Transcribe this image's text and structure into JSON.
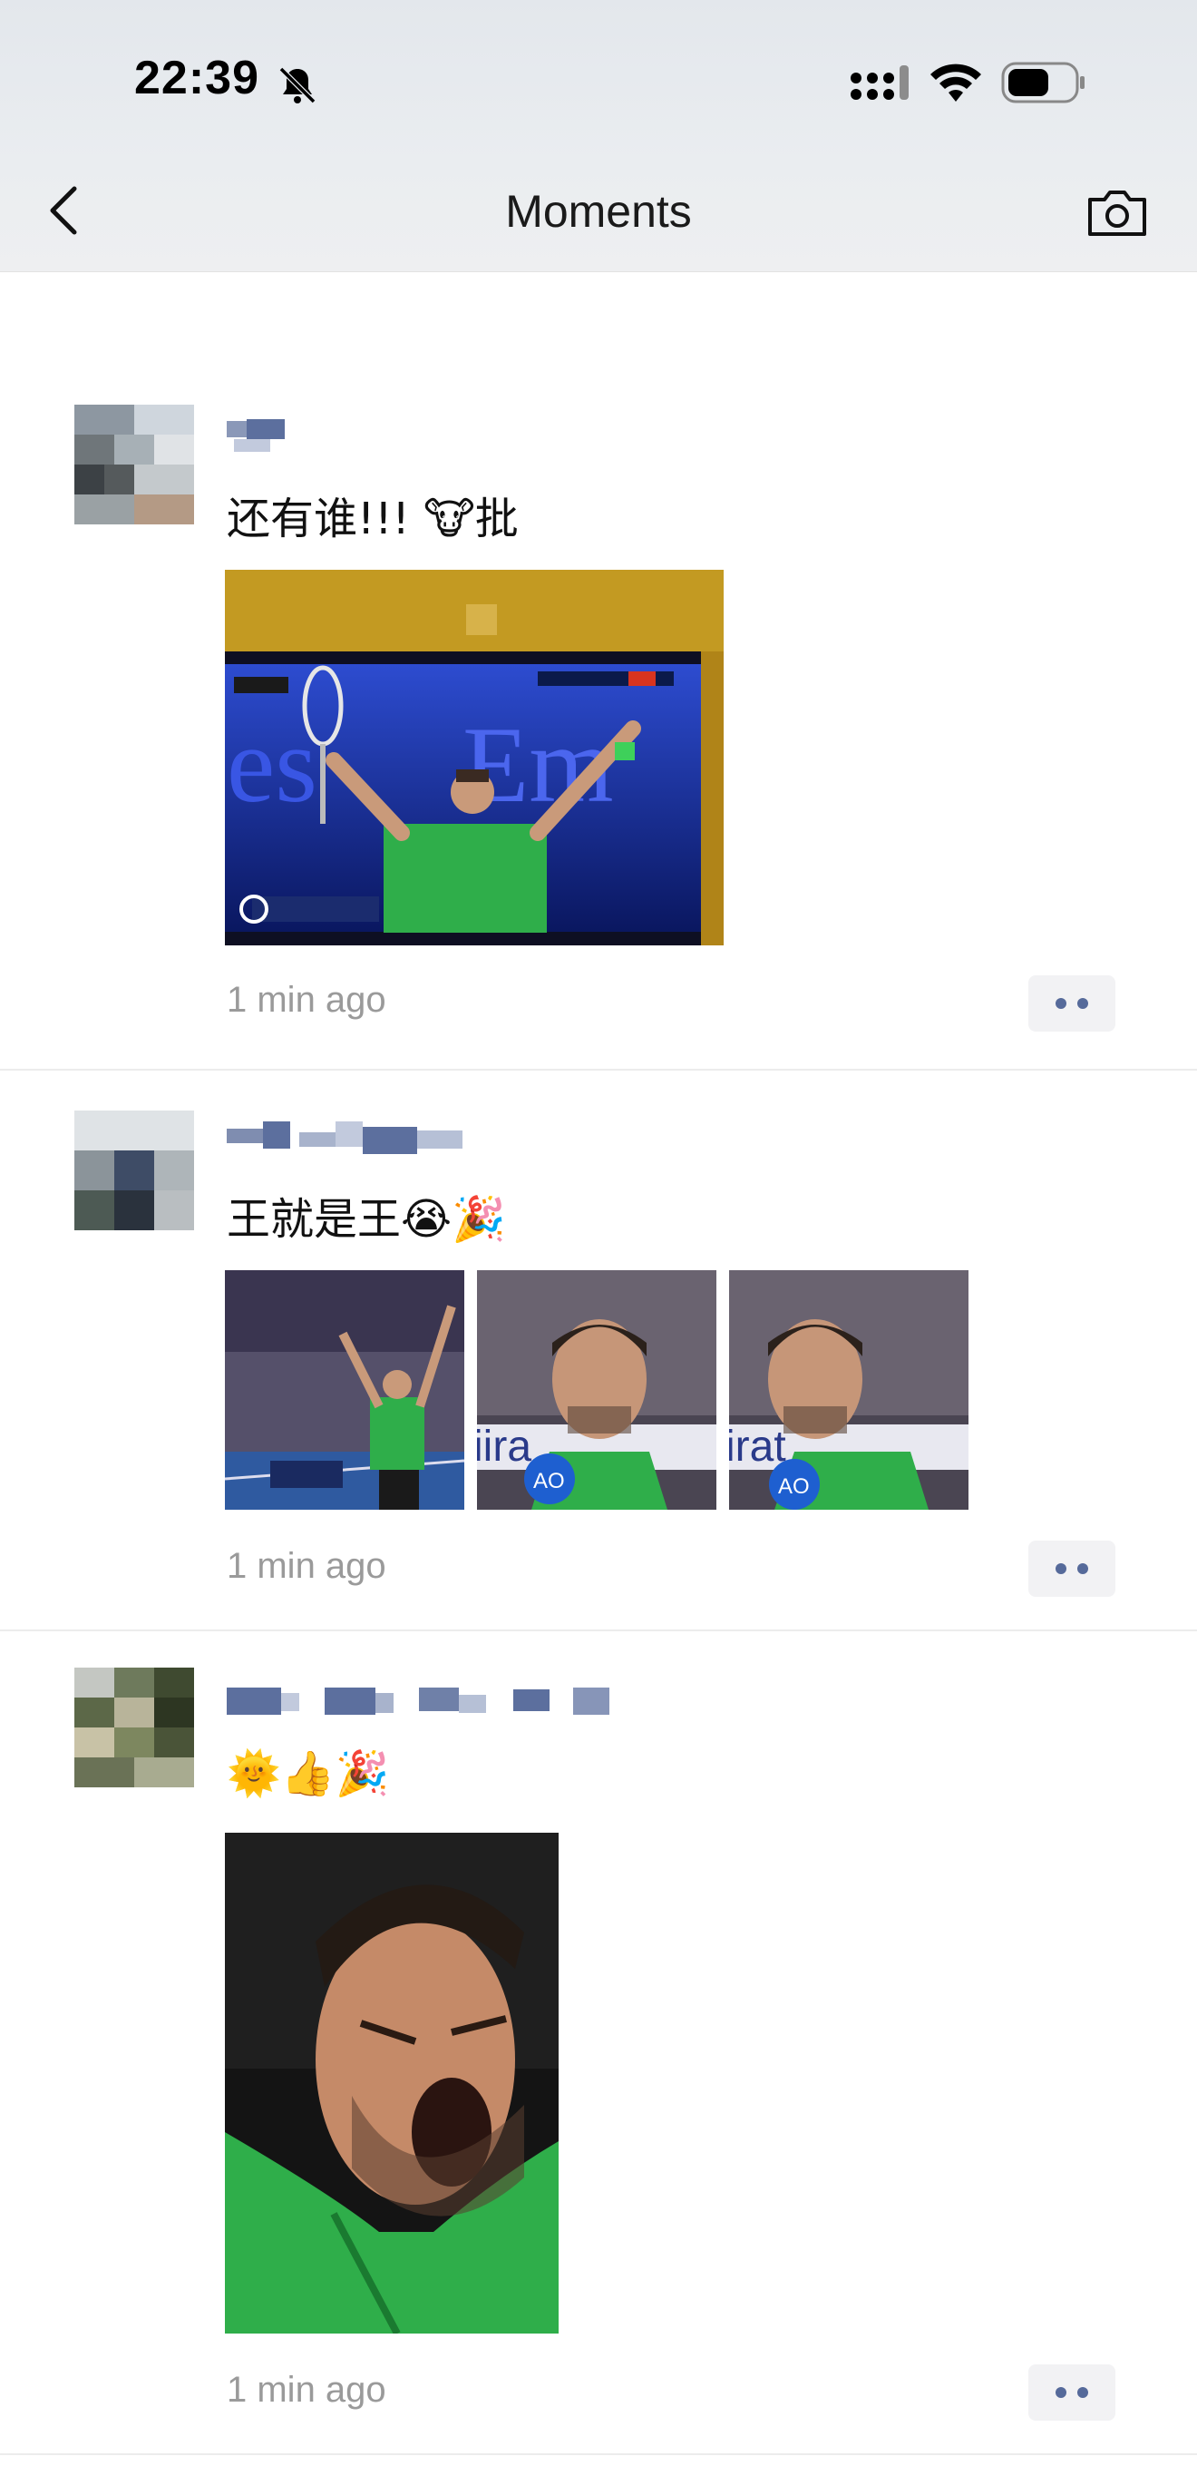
{
  "status_bar": {
    "time": "22:39",
    "icons": [
      "bell-muted-icon",
      "cellular-signal-icon",
      "wifi-icon",
      "battery-icon"
    ]
  },
  "nav": {
    "title": "Moments",
    "back_icon": "chevron-left-icon",
    "camera_icon": "camera-icon"
  },
  "posts": [
    {
      "text": "还有谁!!! 🐮批",
      "timestamp": "1 min ago",
      "images": [
        "tv-screen-player-celebrating"
      ],
      "more_icon": "more-dots-icon"
    },
    {
      "text": "王就是王😭🎉",
      "timestamp": "1 min ago",
      "images": [
        "player-arms-raised-court",
        "player-interview-1",
        "player-interview-2"
      ],
      "more_icon": "more-dots-icon"
    },
    {
      "text": "🌞👍🎉",
      "timestamp": "1 min ago",
      "images": [
        "player-shouting-closeup"
      ],
      "more_icon": "more-dots-icon"
    }
  ],
  "colors": {
    "link_blue": "#566a9a",
    "timestamp_gray": "#9a9a9a",
    "divider": "#ececec",
    "jersey_green": "#2fae4a"
  }
}
